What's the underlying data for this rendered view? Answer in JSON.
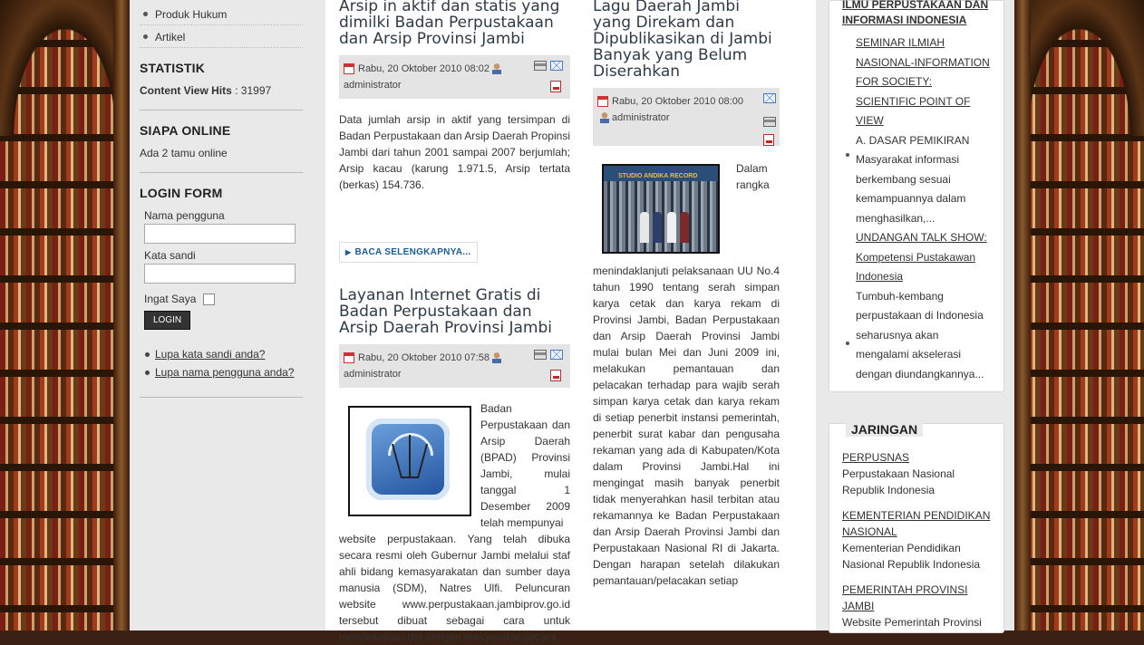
{
  "left_menu": {
    "items": [
      "Produk Hukum",
      "Artikel"
    ]
  },
  "statistik": {
    "title": "STATISTIK",
    "label": "Content View Hits",
    "value": " : 31997"
  },
  "siapa_online": {
    "title": "SIAPA ONLINE",
    "text": "Ada 2 tamu online"
  },
  "login_form": {
    "title": "LOGIN FORM",
    "username_label": "Nama pengguna",
    "username_value": "",
    "password_label": "Kata sandi",
    "password_value": "",
    "remember_label": "Ingat Saya",
    "login_button": "LOGIN",
    "forgot_password": "Lupa kata sandi anda?",
    "forgot_username": "Lupa nama pengguna anda?"
  },
  "articles": [
    {
      "title": "Arsip in aktif dan statis yang dimilki Badan Perpustakaan dan Arsip Provinsi Jambi",
      "date": "Rabu, 20 Oktober 2010 08:02",
      "author": "administrator",
      "body": "Data jumlah arsip in aktif yang tersimpan di Badan Perpustakaan dan Arsip Daerah Propinsi Jambi dari tahun 2001 sampai 2007 berjumlah; Arsip kacau (karung 1.971.5, Arsip tertata (berkas) 154.736.",
      "readmore": "BACA SELENGKAPNYA..."
    },
    {
      "title": "Layanan Internet Gratis di Badan Perpustakaan dan Arsip Daerah Provinsi Jambi",
      "date": "Rabu, 20 Oktober 2010 07:58",
      "author": "administrator",
      "body_side": "Badan Perpustakaan dan Arsip Daerah (BPAD) Provinsi Jambi, mulai tanggal 1 Desember 2009 telah mempunyai",
      "body": "website perpustakaan. Yang telah dibuka secara resmi oleh Gubernur Jambi melalui staf ahli bidang kemasyarakatan dan sumber daya manusia (SDM), Natres Ulfi. Peluncuran website www.perpustakaan.jambiprov.go.id tersebut dibuat sebagai cara untuk mendekatkan diri dengan masyarakat secara"
    },
    {
      "title": "Lagu Daerah Jambi yang Direkam dan Dipublikasikan di Jambi Banyak yang Belum Diserahkan",
      "date": "Rabu, 20 Oktober 2010 08:00",
      "author": "administrator",
      "body_side": "Dalam rangka",
      "photo_sign": "STUDIO ANDIKA RECORD",
      "body": "menindaklanjuti pelaksanaan UU No.4 tahun 1990 tentang serah simpan karya cetak dan karya rekam di Provinsi Jambi, Badan Perpustakaan dan Arsip Daerah Provinsi Jambi mulai bulan Mei dan Juni 2009 ini, melakukan pemantauan dan pelacakan terhadap para wajib serah simpan karya cetak dan karya rekam di setiap penerbit instansi pemerintah, penerbit surat kabar dan pengusaha rekaman yang ada di Kabupaten/Kota dalam Provinsi Jambi.Hal ini mengingat masih banyak penerbit tidak menyerahkan hasil terbitan atau rekamannya ke Badan Perpustakaan dan Arsip Daerah Provinsi Jambi dan Perpustakaan Nasional RI di Jakarta. Dengan harapan setelah dilakukan pemantauan/pelacakan setiap"
    }
  ],
  "right_sidebar": {
    "top_link": "ILMU PERPUSTAKAAN DAN INFORMASI INDONESIA",
    "items": [
      {
        "link": "SEMINAR ILMIAH NASIONAL-INFORMATION FOR SOCIETY: SCIENTIFIC POINT OF VIEW",
        "text": "A. DASAR PEMIKIRAN Masyarakat informasi berkembang sesuai kemampuannya dalam menghasilkan,..."
      },
      {
        "link": "UNDANGAN TALK SHOW: Kompetensi Pustakawan Indonesia",
        "text": "Tumbuh-kembang perpustakaan di Indonesia seharusnya akan mengalami akselerasi dengan diundangkannya..."
      }
    ],
    "jaringan": {
      "title": "JARINGAN",
      "items": [
        {
          "link": "PERPUSNAS",
          "text": "Perpustakaan Nasional Republik Indonesia"
        },
        {
          "link": "KEMENTERIAN PENDIDIKAN NASIONAL",
          "text": "Kementerian Pendidikan Nasional Republik Indonesia"
        },
        {
          "link": "PEMERINTAH PROVINSI JAMBI",
          "text": "Website Pemerintah Provinsi"
        }
      ]
    }
  }
}
